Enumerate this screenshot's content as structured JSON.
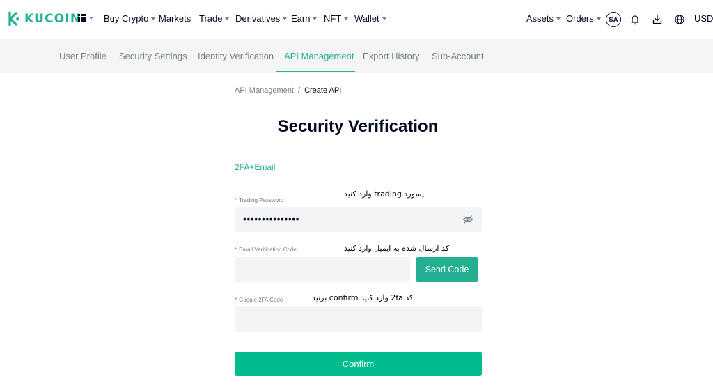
{
  "header": {
    "logo_text": "KUCOIN",
    "nav": [
      {
        "label": "Buy Crypto",
        "dropdown": true
      },
      {
        "label": "Markets",
        "dropdown": false
      },
      {
        "label": "Trade",
        "dropdown": true
      },
      {
        "label": "Derivatives",
        "dropdown": true
      },
      {
        "label": "Earn",
        "dropdown": true
      },
      {
        "label": "NFT",
        "dropdown": true
      },
      {
        "label": "Wallet",
        "dropdown": true
      }
    ],
    "right": {
      "assets_label": "Assets",
      "orders_label": "Orders",
      "avatar_initials": "SA",
      "currency": "USD"
    },
    "icons": [
      "apps-grid-icon",
      "bell-icon",
      "download-icon",
      "globe-icon"
    ]
  },
  "subnav": {
    "tabs": [
      {
        "label": "User Profile",
        "active": false
      },
      {
        "label": "Security Settings",
        "active": false
      },
      {
        "label": "Identity Verification",
        "active": false
      },
      {
        "label": "API Management",
        "active": true
      },
      {
        "label": "Export History",
        "active": false
      },
      {
        "label": "Sub-Account",
        "active": false
      }
    ]
  },
  "breadcrumb": {
    "parent": "API Management",
    "separator": "/",
    "current": "Create API"
  },
  "page": {
    "title": "Security Verification",
    "method": "2FA+Email"
  },
  "form": {
    "required_mark": "*",
    "trading_password": {
      "label": "Trading Password",
      "value": "•••••••••••••••",
      "note": "پسورد trading وارد کنید",
      "icon": "eye-off-icon"
    },
    "email_code": {
      "label": "Email Verification Code",
      "value": "",
      "note": "کد ارسال شده به ایمیل وارد کنید",
      "send_button": "Send Code"
    },
    "google_code": {
      "label": "Google 2FA Code",
      "value": "",
      "note": "کد 2fa وارد کنید confirm بزنید"
    },
    "confirm_button": "Confirm"
  },
  "colors": {
    "brand": "#23af91",
    "button": "#01bc8d",
    "text": "#01081e",
    "muted": "#737e8d",
    "required": "#f65454",
    "subnav_bg": "#f5f5f5",
    "field_bg": "#f3f4f5"
  }
}
